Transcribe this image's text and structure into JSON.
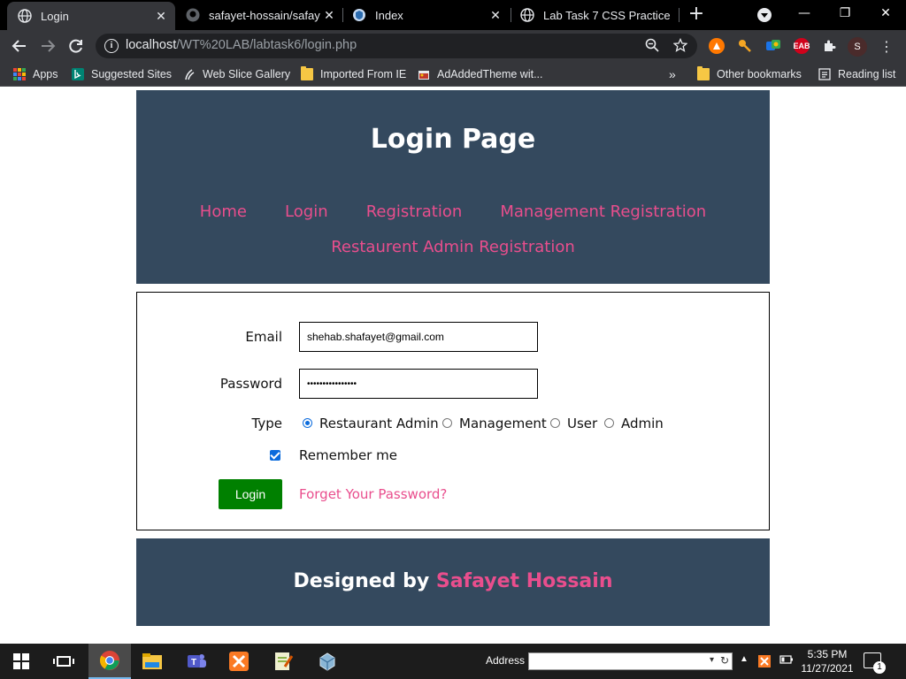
{
  "browser": {
    "tabs": [
      {
        "label": "Login",
        "active": true,
        "icon": "globe-icon"
      },
      {
        "label": "safayet-hossain/safayet",
        "active": false,
        "icon": "github-icon"
      },
      {
        "label": "Index",
        "active": false,
        "icon": "shield-icon"
      },
      {
        "label": "Lab Task 7 CSS Practice",
        "active": false,
        "icon": "globe-icon"
      }
    ],
    "tab_close_glyph": "✕",
    "new_tab_glyph": "+",
    "url_host": "localhost",
    "url_path": "/WT%20LAB/labtask6/login.php",
    "profile_initial": "S",
    "extensions": [
      "avast-icon",
      "key-icon",
      "translate-icon",
      "adblock-icon",
      "puzzle-icon"
    ],
    "adblock_text": "EAB",
    "window_controls": {
      "minimize": "—",
      "restore": "❐",
      "close": "✕"
    }
  },
  "bookmarks": {
    "items": [
      {
        "label": "Apps",
        "icon": "apps-grid-icon"
      },
      {
        "label": "Suggested Sites",
        "icon": "bing-icon"
      },
      {
        "label": "Web Slice Gallery",
        "icon": "web-slice-icon"
      },
      {
        "label": "Imported From IE",
        "icon": "folder-icon"
      },
      {
        "label": "AdAddedTheme wit...",
        "icon": "theme-icon"
      }
    ],
    "overflow": "»",
    "other": "Other bookmarks",
    "reading_list": "Reading list"
  },
  "page": {
    "title": "Login Page",
    "nav": [
      "Home",
      "Login",
      "Registration",
      "Management Registration",
      "Restaurent Admin Registration"
    ],
    "form": {
      "email_label": "Email",
      "email_value": "shehab.shafayet@gmail.com",
      "password_label": "Password",
      "password_value": "••••••••••••••••",
      "type_label": "Type",
      "types": [
        {
          "label": "Restaurant Admin",
          "checked": true
        },
        {
          "label": "Management",
          "checked": false
        },
        {
          "label": "User",
          "checked": false
        },
        {
          "label": "Admin",
          "checked": false
        }
      ],
      "remember_label": "Remember me",
      "remember_checked": true,
      "login_button": "Login",
      "forgot_link": "Forget Your Password?"
    },
    "footer": {
      "prefix": "Designed by",
      "author": "Safayet Hossain"
    },
    "colors": {
      "panel": "#34495e",
      "link": "#e94e8d",
      "login_button": "#008000"
    }
  },
  "taskbar": {
    "address_label": "Address",
    "time": "5:35 PM",
    "date": "11/27/2021",
    "notification_count": "1",
    "apps": [
      "chrome-icon",
      "file-explorer-icon",
      "teams-icon",
      "xampp-icon",
      "notepad-plus-plus-icon",
      "virtualbox-icon"
    ]
  }
}
